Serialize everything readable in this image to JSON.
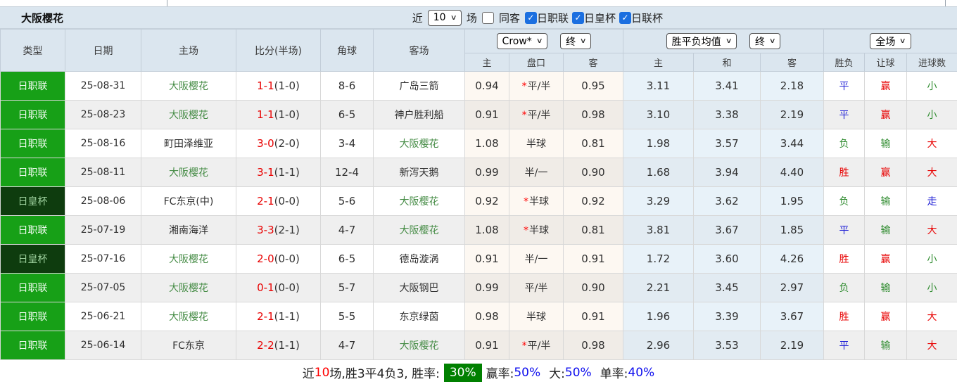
{
  "colors": {
    "league_bg": "#17a017",
    "cup_bg": "#0e3c0e",
    "header_bg": "#dbe6ef",
    "score_red": "#e80000",
    "result_blue": "#2121d6",
    "result_green": "#2e8b2e",
    "team_green": "#468c46",
    "badge_green": "#008000",
    "checkbox_blue": "#1b6fe0"
  },
  "top": {
    "title": "大阪樱花",
    "recent_label": "近",
    "recent_value": "10",
    "games_label": "场",
    "same_away_label": "同客",
    "filters": [
      "日职联",
      "日皇杯",
      "日联杯"
    ]
  },
  "head": {
    "cols": [
      "类型",
      "日期",
      "主场",
      "比分(半场)",
      "角球",
      "客场"
    ],
    "company_select": "Crow*",
    "company_time_select": "终",
    "avg_select": "胜平负均值",
    "avg_time_select": "终",
    "scope_select": "全场",
    "sub": [
      "主",
      "盘口",
      "客",
      "主",
      "和",
      "客",
      "胜负",
      "让球",
      "进球数"
    ]
  },
  "rows": [
    {
      "type": "日职联",
      "cup": false,
      "date": "25-08-31",
      "home": "大阪樱花",
      "home_g": true,
      "score": "1-1",
      "half": "(1-0)",
      "corner": "8-6",
      "away": "广岛三箭",
      "away_g": false,
      "star": true,
      "ah": [
        "0.94",
        "平/半",
        "0.95"
      ],
      "avg": [
        "3.11",
        "3.41",
        "2.18"
      ],
      "res": [
        {
          "t": "平",
          "c": "blue"
        },
        {
          "t": "赢",
          "c": "red"
        },
        {
          "t": "小",
          "c": "green"
        }
      ]
    },
    {
      "type": "日职联",
      "cup": false,
      "date": "25-08-23",
      "home": "大阪樱花",
      "home_g": true,
      "score": "1-1",
      "half": "(1-0)",
      "corner": "6-5",
      "away": "神户胜利船",
      "away_g": false,
      "star": true,
      "ah": [
        "0.91",
        "平/半",
        "0.98"
      ],
      "avg": [
        "3.10",
        "3.38",
        "2.19"
      ],
      "res": [
        {
          "t": "平",
          "c": "blue"
        },
        {
          "t": "赢",
          "c": "red"
        },
        {
          "t": "小",
          "c": "green"
        }
      ]
    },
    {
      "type": "日职联",
      "cup": false,
      "date": "25-08-16",
      "home": "町田泽维亚",
      "home_g": false,
      "score": "3-0",
      "half": "(2-0)",
      "corner": "3-4",
      "away": "大阪樱花",
      "away_g": true,
      "star": false,
      "ah": [
        "1.08",
        "半球",
        "0.81"
      ],
      "avg": [
        "1.98",
        "3.57",
        "3.44"
      ],
      "res": [
        {
          "t": "负",
          "c": "green"
        },
        {
          "t": "输",
          "c": "green"
        },
        {
          "t": "大",
          "c": "red"
        }
      ]
    },
    {
      "type": "日职联",
      "cup": false,
      "date": "25-08-11",
      "home": "大阪樱花",
      "home_g": true,
      "score": "3-1",
      "half": "(1-1)",
      "corner": "12-4",
      "away": "新泻天鹅",
      "away_g": false,
      "star": false,
      "ah": [
        "0.99",
        "半/一",
        "0.90"
      ],
      "avg": [
        "1.68",
        "3.94",
        "4.40"
      ],
      "res": [
        {
          "t": "胜",
          "c": "red"
        },
        {
          "t": "赢",
          "c": "red"
        },
        {
          "t": "大",
          "c": "red"
        }
      ]
    },
    {
      "type": "日皇杯",
      "cup": true,
      "date": "25-08-06",
      "home": "FC东京(中)",
      "home_g": false,
      "score": "2-1",
      "half": "(0-0)",
      "corner": "5-6",
      "away": "大阪樱花",
      "away_g": true,
      "star": true,
      "ah": [
        "0.92",
        "半球",
        "0.92"
      ],
      "avg": [
        "3.29",
        "3.62",
        "1.95"
      ],
      "res": [
        {
          "t": "负",
          "c": "green"
        },
        {
          "t": "输",
          "c": "green"
        },
        {
          "t": "走",
          "c": "blue"
        }
      ]
    },
    {
      "type": "日职联",
      "cup": false,
      "date": "25-07-19",
      "home": "湘南海洋",
      "home_g": false,
      "score": "3-3",
      "half": "(2-1)",
      "corner": "4-7",
      "away": "大阪樱花",
      "away_g": true,
      "star": true,
      "ah": [
        "1.08",
        "半球",
        "0.81"
      ],
      "avg": [
        "3.81",
        "3.67",
        "1.85"
      ],
      "res": [
        {
          "t": "平",
          "c": "blue"
        },
        {
          "t": "输",
          "c": "green"
        },
        {
          "t": "大",
          "c": "red"
        }
      ]
    },
    {
      "type": "日皇杯",
      "cup": true,
      "date": "25-07-16",
      "home": "大阪樱花",
      "home_g": true,
      "score": "2-0",
      "half": "(0-0)",
      "corner": "6-5",
      "away": "德岛漩涡",
      "away_g": false,
      "star": false,
      "ah": [
        "0.91",
        "半/一",
        "0.91"
      ],
      "avg": [
        "1.72",
        "3.60",
        "4.26"
      ],
      "res": [
        {
          "t": "胜",
          "c": "red"
        },
        {
          "t": "赢",
          "c": "red"
        },
        {
          "t": "小",
          "c": "green"
        }
      ]
    },
    {
      "type": "日职联",
      "cup": false,
      "date": "25-07-05",
      "home": "大阪樱花",
      "home_g": true,
      "score": "0-1",
      "half": "(0-0)",
      "corner": "5-7",
      "away": "大阪钢巴",
      "away_g": false,
      "star": false,
      "ah": [
        "0.99",
        "平/半",
        "0.90"
      ],
      "avg": [
        "2.21",
        "3.45",
        "2.97"
      ],
      "res": [
        {
          "t": "负",
          "c": "green"
        },
        {
          "t": "输",
          "c": "green"
        },
        {
          "t": "小",
          "c": "green"
        }
      ]
    },
    {
      "type": "日职联",
      "cup": false,
      "date": "25-06-21",
      "home": "大阪樱花",
      "home_g": true,
      "score": "2-1",
      "half": "(1-1)",
      "corner": "5-5",
      "away": "东京绿茵",
      "away_g": false,
      "star": false,
      "ah": [
        "0.98",
        "半球",
        "0.91"
      ],
      "avg": [
        "1.96",
        "3.39",
        "3.67"
      ],
      "res": [
        {
          "t": "胜",
          "c": "red"
        },
        {
          "t": "赢",
          "c": "red"
        },
        {
          "t": "大",
          "c": "red"
        }
      ]
    },
    {
      "type": "日职联",
      "cup": false,
      "date": "25-06-14",
      "home": "FC东京",
      "home_g": false,
      "score": "2-2",
      "half": "(1-1)",
      "corner": "4-7",
      "away": "大阪樱花",
      "away_g": true,
      "star": true,
      "ah": [
        "0.91",
        "平/半",
        "0.98"
      ],
      "avg": [
        "2.96",
        "3.53",
        "2.19"
      ],
      "res": [
        {
          "t": "平",
          "c": "blue"
        },
        {
          "t": "输",
          "c": "green"
        },
        {
          "t": "大",
          "c": "red"
        }
      ]
    }
  ],
  "footer": {
    "prefix": "近",
    "count": "10",
    "mid": "场,胜3平4负3, 胜率:",
    "rate": "30%",
    "win_label": "赢率:",
    "win": "50%",
    "big_label": "大:",
    "big": "50%",
    "single_label": "单率:",
    "single": "40%"
  },
  "icons": {
    "chevron_down": "∨",
    "check": "✓"
  }
}
